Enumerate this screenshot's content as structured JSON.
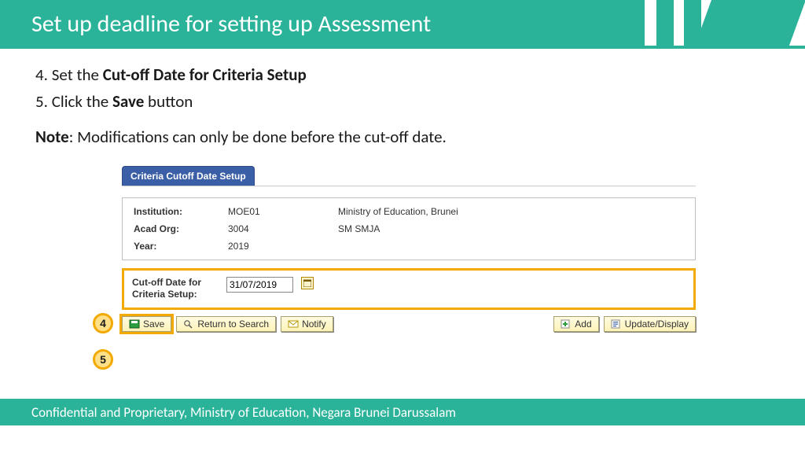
{
  "header": {
    "title": "Set up deadline for setting up Assessment"
  },
  "instructions": {
    "step4_num": "4. ",
    "step4_a": "Set the ",
    "step4_b": "Cut-off Date for Criteria Setup",
    "step5_num": "5. ",
    "step5_a": "Click the ",
    "step5_b": "Save",
    "step5_c": " button",
    "note_label": "Note",
    "note_text": ": Modifications can only be done before the cut-off date."
  },
  "markers": {
    "m4": "4",
    "m5": "5"
  },
  "panel": {
    "tab": "Criteria Cutoff Date Setup",
    "rows": {
      "inst_label": "Institution:",
      "inst_val": "MOE01",
      "inst_desc": "Ministry of Education, Brunei",
      "org_label": "Acad Org:",
      "org_val": "3004",
      "org_desc": "SM SMJA",
      "year_label": "Year:",
      "year_val": "2019"
    },
    "cutoff": {
      "label": "Cut-off Date for Criteria Setup:",
      "value": "31/07/2019"
    },
    "buttons": {
      "save": "Save",
      "return": "Return to Search",
      "notify": "Notify",
      "add": "Add",
      "update": "Update/Display"
    }
  },
  "footer": "Confidential and Proprietary, Ministry of Education, Negara Brunei Darussalam"
}
